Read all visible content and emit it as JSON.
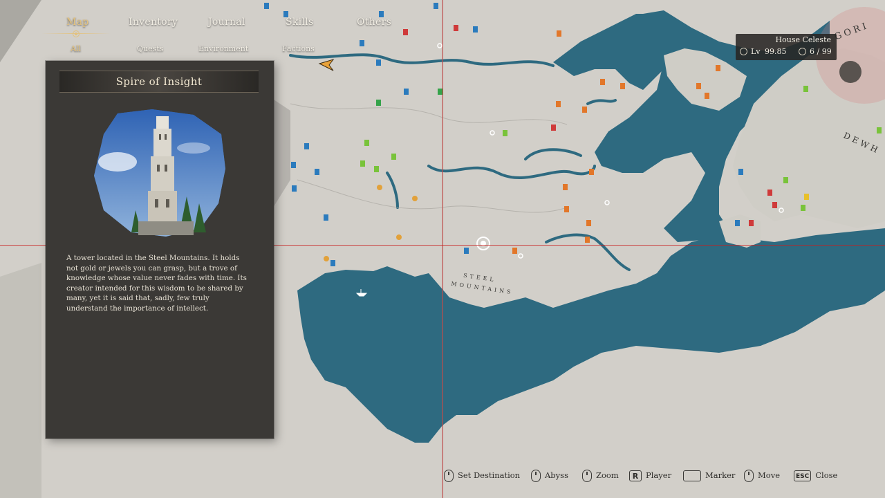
{
  "nav": {
    "main_tabs": [
      {
        "label": "Map",
        "active": true
      },
      {
        "label": "Inventory",
        "active": false
      },
      {
        "label": "Journal",
        "active": false
      },
      {
        "label": "Skills",
        "active": false
      },
      {
        "label": "Others",
        "active": false
      }
    ],
    "sub_tabs": [
      {
        "label": "All",
        "active": true
      },
      {
        "label": "Quests",
        "active": false
      },
      {
        "label": "Environment",
        "active": false
      },
      {
        "label": "Factions",
        "active": false
      }
    ]
  },
  "info_panel": {
    "title": "Spire of Insight",
    "description": "A tower located in the Steel Mountains. It holds not gold or jewels you can grasp, but a trove of knowledge whose value never fades with time. Its creator intended for this wisdom to be shared by many, yet it is said that, sadly, few truly understand the importance of intellect."
  },
  "player": {
    "house": "House Celeste",
    "level_label": "Lv",
    "level": "99.85",
    "count": "6 / 99"
  },
  "map": {
    "region_label_line1": "STEEL",
    "region_label_line2": "MOUNTAINS",
    "edge_label_1": "GORI",
    "edge_label_2": "DEWH",
    "colors": {
      "land": "#cfcdc6",
      "water": "#2e6a80",
      "crosshair": "#c81e1e"
    }
  },
  "controls": [
    {
      "glyph": "mouse",
      "label": "Set Destination"
    },
    {
      "glyph": "mouse",
      "label": "Abyss"
    },
    {
      "glyph": "mouse",
      "label": "Zoom"
    },
    {
      "glyph": "R",
      "label": "Player"
    },
    {
      "glyph": "space",
      "label": "Marker"
    },
    {
      "glyph": "move",
      "label": "Move"
    },
    {
      "glyph": "ESC",
      "label": "Close"
    }
  ]
}
